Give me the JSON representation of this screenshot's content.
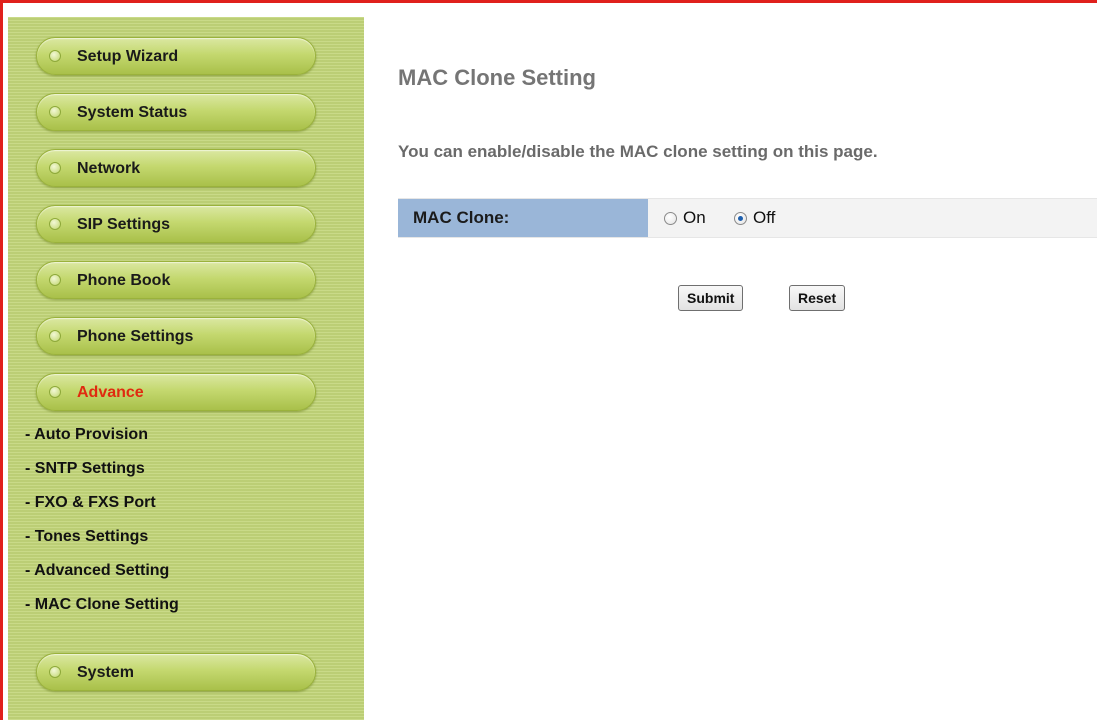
{
  "sidebar": {
    "menu": [
      {
        "label": "Setup Wizard",
        "active": false
      },
      {
        "label": "System Status",
        "active": false
      },
      {
        "label": "Network",
        "active": false
      },
      {
        "label": "SIP Settings",
        "active": false
      },
      {
        "label": "Phone Book",
        "active": false
      },
      {
        "label": "Phone Settings",
        "active": false
      },
      {
        "label": "Advance",
        "active": true
      },
      {
        "label": "System",
        "active": false
      }
    ],
    "submenu": [
      "- Auto Provision",
      "- SNTP Settings",
      "- FXO & FXS Port",
      "- Tones Settings",
      "- Advanced Setting",
      "- MAC Clone Setting"
    ],
    "active_color": "#e02a10"
  },
  "main": {
    "title": "MAC Clone Setting",
    "description": "You can enable/disable the MAC clone setting on this page.",
    "mac_clone": {
      "label": "MAC Clone:",
      "options": [
        {
          "label": "On",
          "checked": false
        },
        {
          "label": "Off",
          "checked": true
        }
      ]
    },
    "buttons": {
      "submit": "Submit",
      "reset": "Reset"
    }
  },
  "colors": {
    "frame_border": "#e0201c",
    "sidebar_bg": "#c3d67a",
    "label_cell_bg": "#9ab6d8"
  }
}
